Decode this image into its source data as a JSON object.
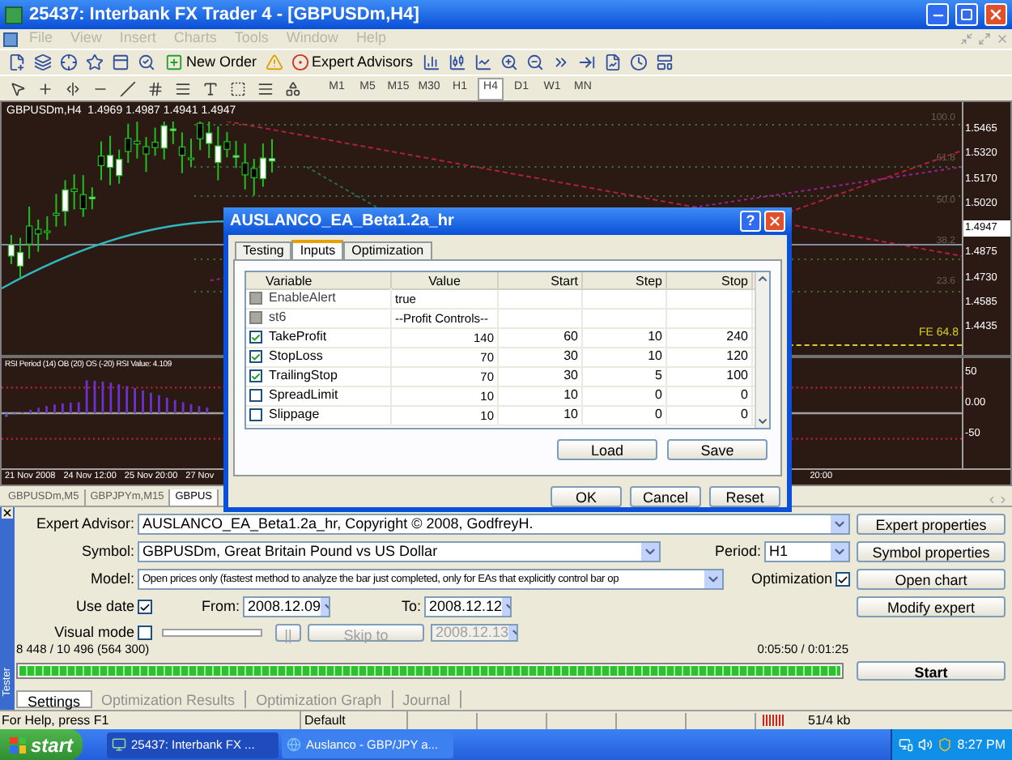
{
  "window": {
    "title": "25437: Interbank FX Trader 4 - [GBPUSDm,H4]"
  },
  "menu": {
    "disabled": true,
    "items": [
      "File",
      "View",
      "Insert",
      "Charts",
      "Tools",
      "Window",
      "Help"
    ]
  },
  "toolbar": {
    "buttons": [
      "New Order",
      "Expert Advisors"
    ]
  },
  "timeframes": [
    {
      "label": "M1",
      "selected": false
    },
    {
      "label": "M5",
      "selected": false
    },
    {
      "label": "M15",
      "selected": false
    },
    {
      "label": "M30",
      "selected": false
    },
    {
      "label": "H1",
      "selected": false
    },
    {
      "label": "H4",
      "selected": true
    },
    {
      "label": "D1",
      "selected": false
    },
    {
      "label": "W1",
      "selected": false
    },
    {
      "label": "MN",
      "selected": false
    }
  ],
  "chart": {
    "header": "GBPUSDm,H4  1.4969 1.4987 1.4941 1.4947",
    "price_labels": [
      {
        "label": "1.5465",
        "kind": "tick"
      },
      {
        "label": "1.5320",
        "kind": "tick"
      },
      {
        "label": "1.5170",
        "kind": "tick"
      },
      {
        "label": "1.5020",
        "kind": "tick"
      },
      {
        "label": "1.4947",
        "kind": "current"
      },
      {
        "label": "1.4875",
        "kind": "tick"
      },
      {
        "label": "1.4730",
        "kind": "tick"
      },
      {
        "label": "1.4585",
        "kind": "tick"
      },
      {
        "label": "1.4435",
        "kind": "tick"
      }
    ],
    "level_labels": [
      "100.0",
      "61.8",
      "50.0",
      "38.2",
      "23.6"
    ],
    "indicator_label": "FE 64.8",
    "rsi": {
      "label": "RSI Period (14) OB (20) OS (-20) RSI Value: 4.109",
      "axis": [
        "50",
        "0.00",
        "-50"
      ]
    },
    "time_labels": [
      "21 Nov 2008",
      "24 Nov 12:00",
      "25 Nov 20:00",
      "27 Nov"
    ],
    "time_label_right": "20:00"
  },
  "chart_tabs": [
    {
      "label": "GBPUSDm,M5",
      "selected": false
    },
    {
      "label": "GBPJPYm,M15",
      "selected": false
    },
    {
      "label": "GBPUS",
      "selected": true
    }
  ],
  "dialog": {
    "title": "AUSLANCO_EA_Beta1.2a_hr",
    "help": "?",
    "tabs": [
      {
        "label": "Testing",
        "selected": false
      },
      {
        "label": "Inputs",
        "selected": true
      },
      {
        "label": "Optimization",
        "selected": false
      }
    ],
    "columns": [
      "Variable",
      "Value",
      "Start",
      "Step",
      "Stop"
    ],
    "rows": [
      {
        "variable": "EnableAlert",
        "value": "true",
        "kind": "text",
        "checked": false,
        "disabled": true
      },
      {
        "variable": "st6",
        "value": "--Profit Controls--",
        "kind": "text",
        "checked": false,
        "disabled": true
      },
      {
        "variable": "TakeProfit",
        "value": "140",
        "start": "60",
        "step": "10",
        "stop": "240",
        "kind": "number",
        "checked": true,
        "disabled": false
      },
      {
        "variable": "StopLoss",
        "value": "70",
        "start": "30",
        "step": "10",
        "stop": "120",
        "kind": "number",
        "checked": true,
        "disabled": false
      },
      {
        "variable": "TrailingStop",
        "value": "70",
        "start": "30",
        "step": "5",
        "stop": "100",
        "kind": "number",
        "checked": true,
        "disabled": false
      },
      {
        "variable": "SpreadLimit",
        "value": "10",
        "start": "10",
        "step": "0",
        "stop": "0",
        "kind": "number",
        "checked": false,
        "disabled": false
      },
      {
        "variable": "Slippage",
        "value": "10",
        "start": "10",
        "step": "0",
        "stop": "0",
        "kind": "number",
        "checked": false,
        "disabled": false
      }
    ],
    "panel_buttons": [
      "Load",
      "Save"
    ],
    "footer_buttons": [
      "OK",
      "Cancel",
      "Reset"
    ]
  },
  "tester": {
    "title": "Tester",
    "expert_label": "Expert Advisor:",
    "expert": "AUSLANCO_EA_Beta1.2a_hr, Copyright © 2008, GodfreyH.",
    "symbol_label": "Symbol:",
    "symbol": "GBPUSDm, Great Britain Pound vs US Dollar",
    "period_label": "Period:",
    "period": "H1",
    "model_label": "Model:",
    "model": "Open prices only (fastest method to analyze the bar just completed, only for EAs that explicitly control bar op",
    "optimization": {
      "label": "Optimization",
      "checked": true
    },
    "use_date": {
      "label": "Use date",
      "checked": true
    },
    "from_label": "From:",
    "from": "2008.12.09",
    "to_label": "To:",
    "to": "2008.12.12",
    "visual_mode": {
      "label": "Visual mode",
      "checked": false
    },
    "pause": "||",
    "skip": "Skip to",
    "skip_date": "2008.12.13",
    "counts": "8 448 / 10 496 (564 300)",
    "time": "0:05:50 / 0:01:25",
    "progress": {
      "level": 1
    },
    "buttons": [
      "Expert properties",
      "Symbol properties",
      "Open chart",
      "Modify expert"
    ],
    "start": "Start",
    "tabs": [
      {
        "label": "Settings",
        "selected": true
      },
      {
        "label": "Optimization Results",
        "selected": false
      },
      {
        "label": "Optimization Graph",
        "selected": false
      },
      {
        "label": "Journal",
        "selected": false
      }
    ]
  },
  "status_bar": {
    "help": "For Help, press F1",
    "profile": "Default",
    "traffic": "51/4 kb"
  },
  "taskbar": {
    "start": "start",
    "items": [
      {
        "label": "25437: Interbank FX ...",
        "selected": true
      },
      {
        "label": "Auslanco - GBP/JPY a...",
        "selected": false
      }
    ],
    "clock": "8:27 PM"
  }
}
